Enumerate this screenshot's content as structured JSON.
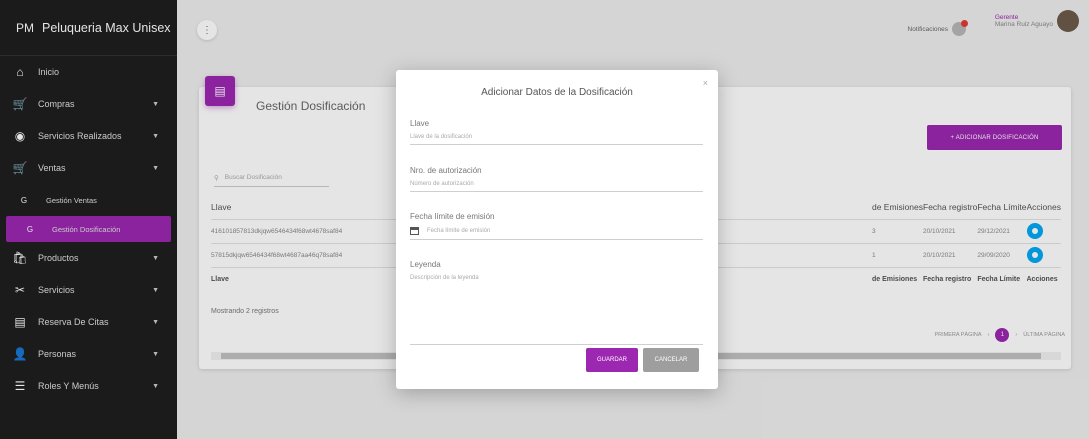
{
  "brand": {
    "abbr": "PM",
    "name": "Peluqueria Max Unisex"
  },
  "sidebar": {
    "items": [
      {
        "icon": "home-icon",
        "glyph": "⌂",
        "label": "Inicio",
        "caret": false,
        "sub": false,
        "active": false
      },
      {
        "icon": "cart-icon",
        "glyph": "🛒",
        "label": "Compras",
        "caret": true,
        "sub": false,
        "active": false
      },
      {
        "icon": "services-done-icon",
        "glyph": "◉",
        "label": "Servicios Realizados",
        "caret": true,
        "sub": false,
        "active": false
      },
      {
        "icon": "sales-icon",
        "glyph": "🛒",
        "label": "Ventas",
        "caret": true,
        "sub": false,
        "active": false
      },
      {
        "icon": "g-icon",
        "glyph": "G",
        "label": "Gestión Ventas",
        "caret": false,
        "sub": true,
        "active": false
      },
      {
        "icon": "g-icon",
        "glyph": "G",
        "label": "Gestión Dosificación",
        "caret": false,
        "sub": true,
        "active": true
      },
      {
        "icon": "products-icon",
        "glyph": "🛍",
        "label": "Productos",
        "caret": true,
        "sub": false,
        "active": false
      },
      {
        "icon": "scissors-icon",
        "glyph": "✂",
        "label": "Servicios",
        "caret": true,
        "sub": false,
        "active": false
      },
      {
        "icon": "calendar-icon",
        "glyph": "▤",
        "label": "Reserva De Citas",
        "caret": true,
        "sub": false,
        "active": false
      },
      {
        "icon": "person-icon",
        "glyph": "👤",
        "label": "Personas",
        "caret": true,
        "sub": false,
        "active": false
      },
      {
        "icon": "menu-list-icon",
        "glyph": "☰",
        "label": "Roles Y Menús",
        "caret": true,
        "sub": false,
        "active": false
      }
    ]
  },
  "topbar": {
    "menu_glyph": "⋮",
    "notifications_label": "Notificaciones",
    "role": "Gerente",
    "user_name": "Marina Ruiz Aguayo"
  },
  "card": {
    "title": "Gestión Dosificación",
    "add_button": "+ ADICIONAR DOSIFICACIÓN",
    "search_placeholder": "Buscar Dosificación",
    "columns": [
      "Llave",
      "de Emisiones",
      "Fecha registro",
      "Fecha Límite",
      "Acciones"
    ],
    "footer": [
      "Llave",
      "de Emisiones",
      "Fecha registro",
      "Fecha Límite",
      "Acciones"
    ],
    "rows": [
      {
        "key": "416101857813dkjqw6546434f68wt4678saf84",
        "emissions": "3",
        "registered": "20/10/2021",
        "limit": "29/12/2021"
      },
      {
        "key": "57815dkjqw6546434f68wt4687aa46q78saf84",
        "emissions": "1",
        "registered": "20/10/2021",
        "limit": "29/09/2020"
      }
    ],
    "showing": "Mostrando 2 registros",
    "pager": {
      "first": "PRIMERA PÁGINA",
      "prev": "‹",
      "page": "1",
      "next": "›",
      "last": "ÚLTIMA PÁGINA"
    }
  },
  "modal": {
    "title": "Adicionar Datos de la Dosificación",
    "close": "×",
    "fields": [
      {
        "label": "Llave",
        "placeholder": "Llave de la dosificación"
      },
      {
        "label": "Nro. de autorización",
        "placeholder": "Número de autorización"
      },
      {
        "label": "Fecha límite de emisión",
        "placeholder": "Fecha límite de emisión"
      },
      {
        "label": "Leyenda",
        "placeholder": "Descripción de la leyenda"
      }
    ],
    "save": "GUARDAR",
    "cancel": "CANCELAR"
  },
  "colors": {
    "accent": "#9c27b0",
    "info": "#03a9f4",
    "sidebar": "#1f1f1f"
  }
}
